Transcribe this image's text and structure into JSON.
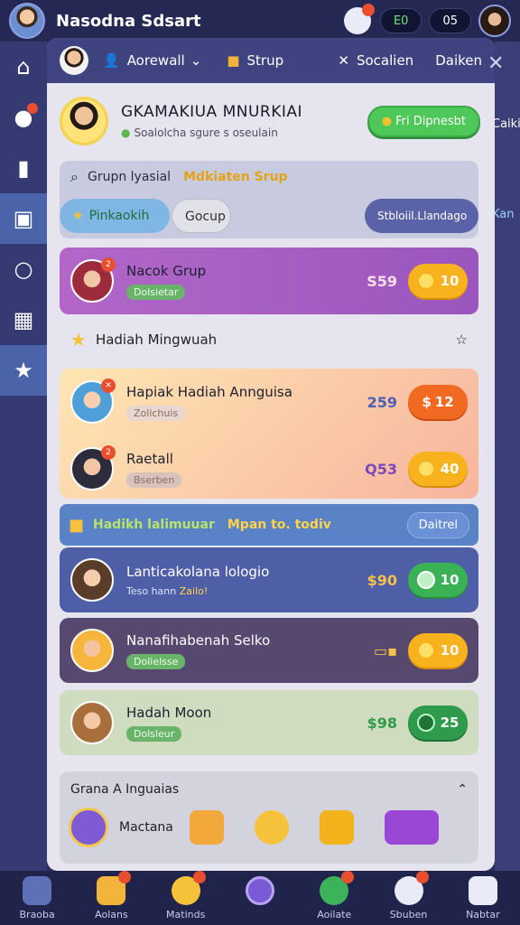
{
  "topbar": {
    "title": "Nasodna Sdsart",
    "pill1": "E0",
    "pill2": "05"
  },
  "panel_head": {
    "items": [
      {
        "label": "Aorewall",
        "icon": "user-icon"
      },
      {
        "label": "Strup",
        "icon": "box-icon"
      }
    ],
    "right1": "Socalien",
    "right2": "Daiken"
  },
  "profile": {
    "name": "GKAMAKIUA MNURKIAI",
    "sub": "Soalolcha sgure s oseulain",
    "cta": "Fri Dipnesbt"
  },
  "group": {
    "label": "Grupn lyasial",
    "highlight": "Mdkiaten Srup",
    "chips": [
      "Pinkaokih",
      "Gocup",
      "Stbloiil.Llandago"
    ]
  },
  "side_tags": {
    "a": "Caiki",
    "b": "Kan"
  },
  "rows": [
    {
      "name": "Nacok Grup",
      "tag": "Dolsietar",
      "price": "S59",
      "coins": "10"
    },
    {
      "name": "Hapiak Hadiah Annguisa",
      "tag": "Zolichuis",
      "price": "259",
      "coins": "12"
    },
    {
      "name": "Raetall",
      "tag": "Bserben",
      "price": "Q53",
      "coins": "40"
    },
    {
      "name": "Lanticakolana lologio",
      "tag": "Zailo!",
      "tag_prefix": "Teso hann",
      "price": "$90",
      "coins": "10"
    },
    {
      "name": "Nanafihabenah Selko",
      "tag": "Dolielsse",
      "price": "",
      "coins": "10"
    },
    {
      "name": "Hadah Moon",
      "tag": "Dolsleur",
      "price": "$98",
      "coins": "25"
    }
  ],
  "weekly": {
    "label": "Hadiah Mingwuah"
  },
  "banner": {
    "t1": "Hadikh lalimuuar",
    "t2": "Mpan to. todiv",
    "btn": "Daitrel"
  },
  "section": {
    "title": "Grana A Inguaias",
    "item": "Mactana"
  },
  "bottom_nav": [
    "Braoba",
    "Aolans",
    "Matinds",
    "",
    "Aoilate",
    "Sbuben",
    "Nabtar"
  ],
  "colors": {
    "accent": "#4b63a9",
    "green": "#4fc85a",
    "orange": "#f7b21d"
  }
}
